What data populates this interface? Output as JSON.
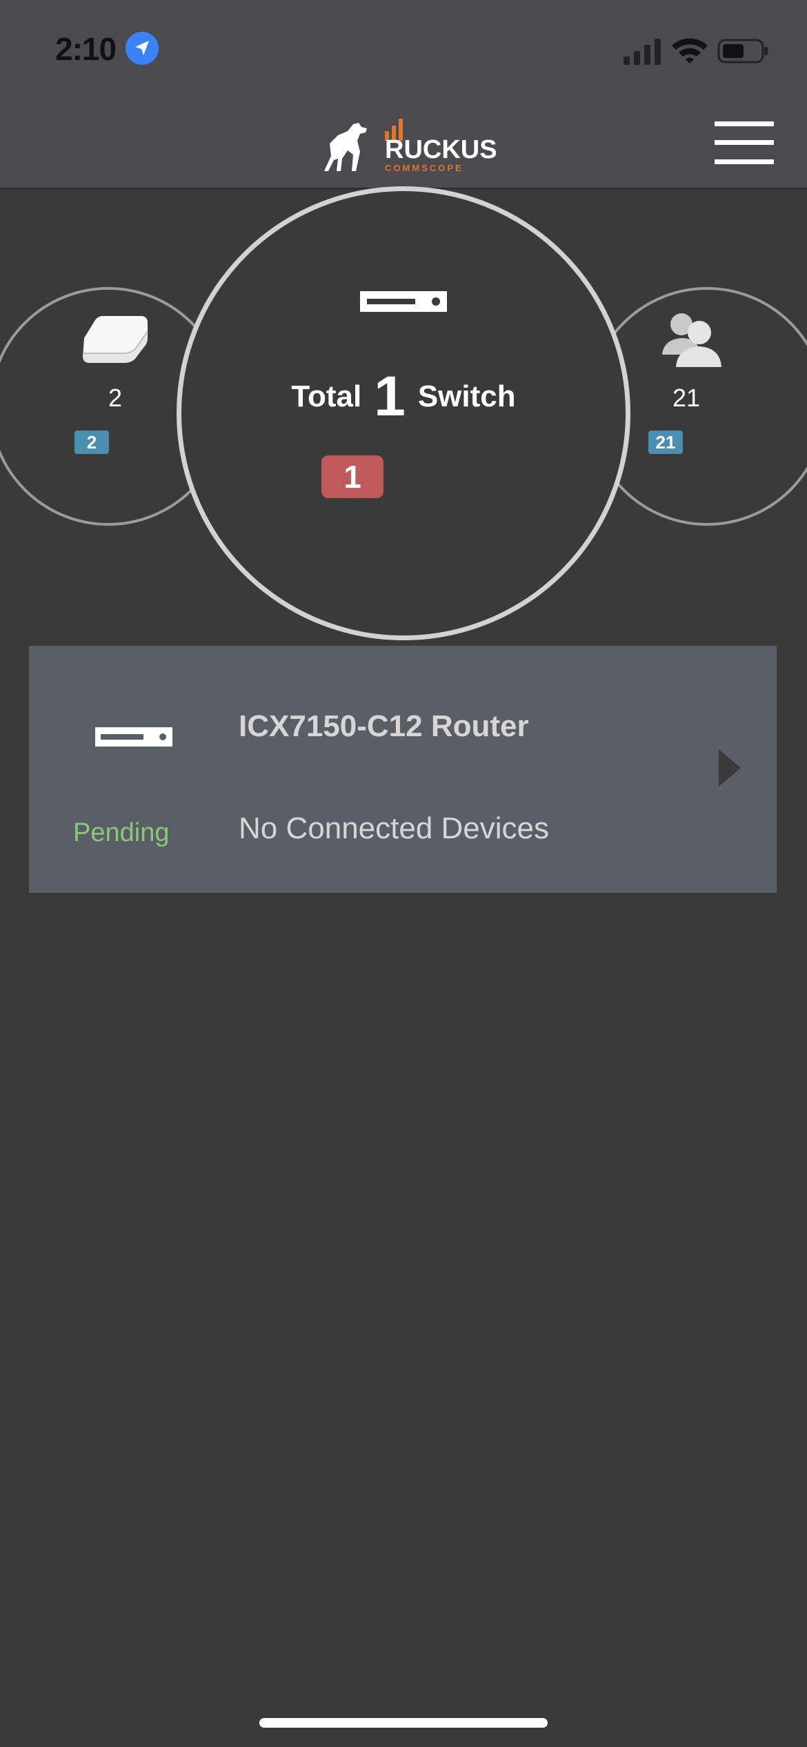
{
  "status_bar": {
    "time": "2:10"
  },
  "header": {
    "logo_text": "RUCKUS",
    "logo_subtext": "COMMSCOPE"
  },
  "summary": {
    "access_points": {
      "count": "2",
      "badge": "2"
    },
    "switches": {
      "total_label": "Total",
      "total_count": "1",
      "type_label": "Switch",
      "alert_badge": "1"
    },
    "clients": {
      "count": "21",
      "badge": "21"
    }
  },
  "devices": [
    {
      "name": "ICX7150-C12 Router",
      "status": "Pending",
      "detail": "No Connected Devices"
    }
  ],
  "colors": {
    "background": "#3a3a3b",
    "header": "#4b4a4f",
    "card": "#5a5f67",
    "pending": "#8bc77a",
    "alert_badge": "#c05a5a",
    "info_badge": "#4a8fb0",
    "brand_orange": "#e0752b"
  },
  "icons": [
    "location-arrow-icon",
    "cellular-signal-icon",
    "wifi-icon",
    "battery-icon",
    "ruckus-dog-logo",
    "hamburger-menu-icon",
    "access-point-icon",
    "users-icon",
    "switch-icon",
    "chevron-right-icon"
  ]
}
